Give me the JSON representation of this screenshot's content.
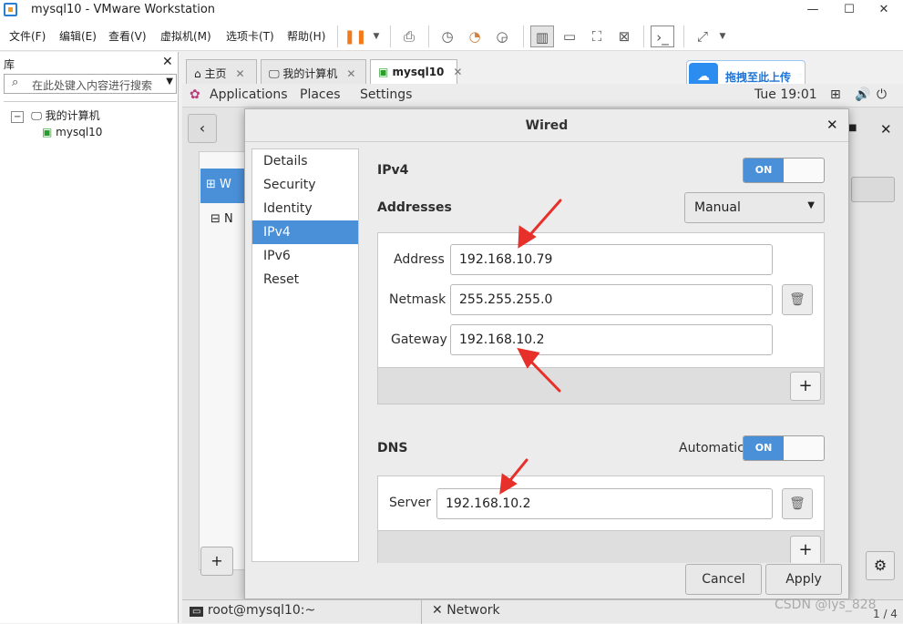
{
  "window": {
    "title": "mysql10 - VMware Workstation",
    "minimize": "—",
    "maximize": "☐",
    "close": "✕"
  },
  "menu": [
    "文件(F)",
    "编辑(E)",
    "查看(V)",
    "虚拟机(M)",
    "选项卡(T)",
    "帮助(H)"
  ],
  "library": {
    "title": "库",
    "close": "✕",
    "search_placeholder": "在此处键入内容进行搜索",
    "tree": [
      "我的计算机",
      "mysql10"
    ]
  },
  "tabs": [
    {
      "label": "主页"
    },
    {
      "label": "我的计算机"
    },
    {
      "label": "mysql10"
    }
  ],
  "upload": {
    "label": "拖拽至此上传"
  },
  "gnome": {
    "applications": "Applications",
    "places": "Places",
    "settings": "Settings",
    "clock": "Tue 19:01"
  },
  "background": {
    "list_item_1": "W",
    "list_item_2": "N"
  },
  "dialog": {
    "title": "Wired",
    "close": "✕",
    "sidebar": [
      "Details",
      "Security",
      "Identity",
      "IPv4",
      "IPv6",
      "Reset"
    ],
    "ipv4": {
      "label": "IPv4",
      "switch": "ON"
    },
    "addresses": {
      "label": "Addresses",
      "method": "Manual",
      "address_label": "Address",
      "address": "192.168.10.79",
      "netmask_label": "Netmask",
      "netmask": "255.255.255.0",
      "gateway_label": "Gateway",
      "gateway": "192.168.10.2",
      "add": "+"
    },
    "dns": {
      "label": "DNS",
      "automatic_label": "Automatic",
      "switch": "ON",
      "server_label": "Server",
      "server": "192.168.10.2",
      "add": "+"
    },
    "cancel": "Cancel",
    "apply": "Apply"
  },
  "taskbar": {
    "terminal": "root@mysql10:~",
    "network": "Network",
    "pager": "1 / 4"
  },
  "watermark": "CSDN @lys_828",
  "colors": {
    "accent": "#4a90d9",
    "arrow": "#e8302a",
    "upload": "#2b8df0"
  }
}
